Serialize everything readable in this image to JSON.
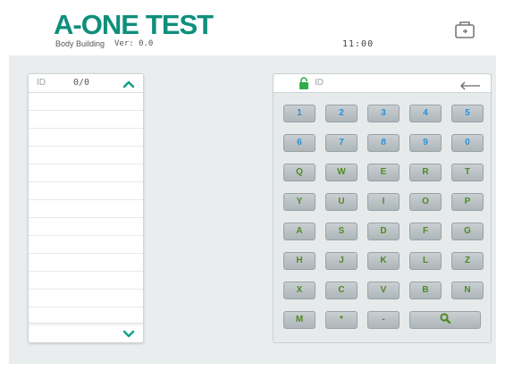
{
  "header": {
    "brand_part1": "A-ONE",
    "brand_part2": "TEST",
    "subtitle": "Body Building",
    "version": "Ver: 0.0",
    "time": "11:00"
  },
  "list": {
    "id_label": "ID",
    "count": "0/0"
  },
  "keypad": {
    "id_placeholder": "ID",
    "rows": [
      [
        "1",
        "2",
        "3",
        "4",
        "5"
      ],
      [
        "6",
        "7",
        "8",
        "9",
        "0"
      ],
      [
        "Q",
        "W",
        "E",
        "R",
        "T"
      ],
      [
        "Y",
        "U",
        "I",
        "O",
        "P"
      ],
      [
        "A",
        "S",
        "D",
        "F",
        "G"
      ],
      [
        "H",
        "J",
        "K",
        "L",
        "Z"
      ],
      [
        "X",
        "C",
        "V",
        "B",
        "N"
      ],
      [
        "M",
        "*",
        "-"
      ]
    ],
    "search_icon": "search-icon"
  },
  "colors": {
    "brand": "#0e8f7c",
    "number_key_text": "#2b8fd6",
    "letter_key_text": "#4f8a23",
    "chevron": "#13a08a",
    "lock": "#2eae4a"
  }
}
